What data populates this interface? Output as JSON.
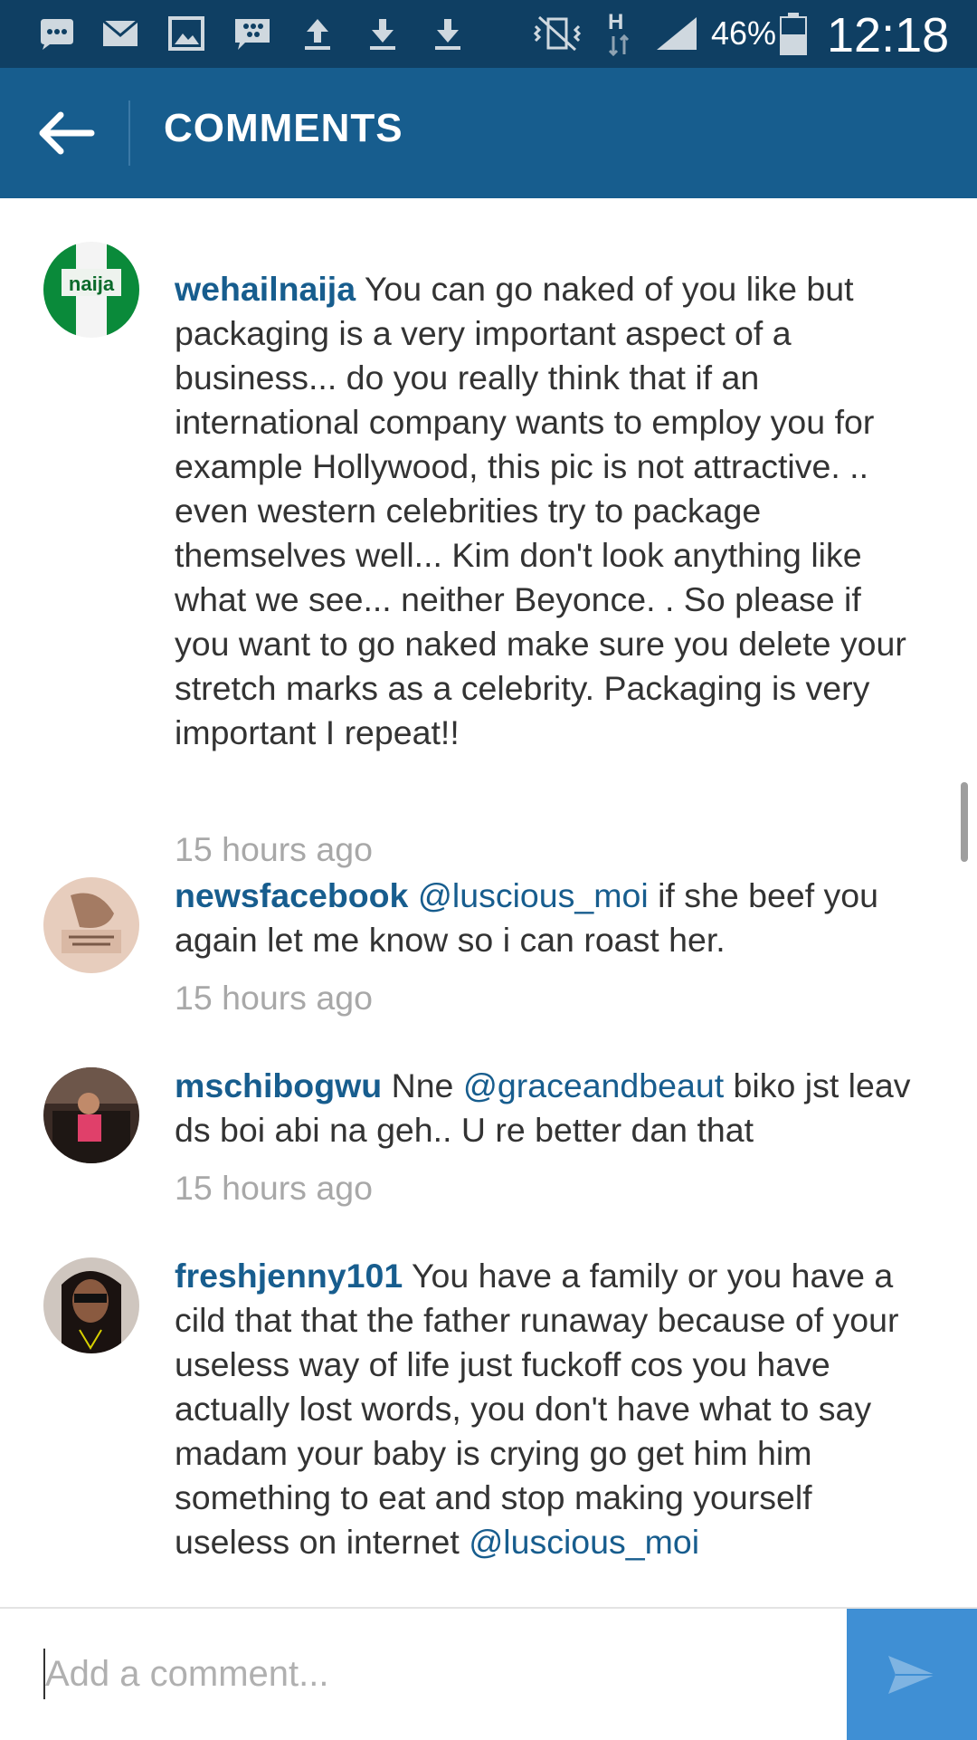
{
  "status_bar": {
    "battery_percent": "46%",
    "time": "12:18",
    "network_type": "H",
    "icons": [
      "chat-icon",
      "mail-icon",
      "image-icon",
      "bbm-icon",
      "upload-icon",
      "download-icon",
      "download-icon",
      "vibrate-mute-icon",
      "network-h-icon",
      "signal-icon",
      "battery-icon"
    ]
  },
  "app_bar": {
    "title": "COMMENTS",
    "back_icon": "arrow-left-icon"
  },
  "comments": [
    {
      "username": "wehailnaija",
      "avatar_label": "naija",
      "text": " You can go naked of you like but packaging is a very important aspect of a business... do you really think that if an international company wants to employ you for example Hollywood, this pic is not attractive. .. even western celebrities try to package themselves well... Kim don't look anything like what we see... neither Beyonce. . So please if you want to go naked make sure you delete your stretch marks as a celebrity. Packaging is very important I repeat!!",
      "time": "15 hours ago"
    },
    {
      "username": "newsfacebook",
      "mention": "@luscious_moi",
      "text": " if she beef you again let me know so i can roast her.",
      "time": "15 hours ago"
    },
    {
      "username": "mschibogwu",
      "text_pre": " Nne ",
      "mention": "@graceandbeaut",
      "text": " biko jst leav ds boi abi na geh.. U re better dan that",
      "time": "15 hours ago"
    },
    {
      "username": "freshjenny101",
      "text": " You have a family or you have a cild that that the father runaway because of your useless way of life just fuckoff cos you have actually lost words, you don't have what to say madam your baby is crying go get him  him something to eat and stop making yourself useless on internet ",
      "mention": "@luscious_moi"
    }
  ],
  "composer": {
    "placeholder": "Add a comment...",
    "value": "",
    "send_icon": "send-icon"
  },
  "colors": {
    "status_bar": "#0f3f63",
    "app_bar": "#175d8e",
    "username": "#175d8e",
    "timestamp": "#a8a8a8",
    "send_button": "#3f8fd4"
  }
}
